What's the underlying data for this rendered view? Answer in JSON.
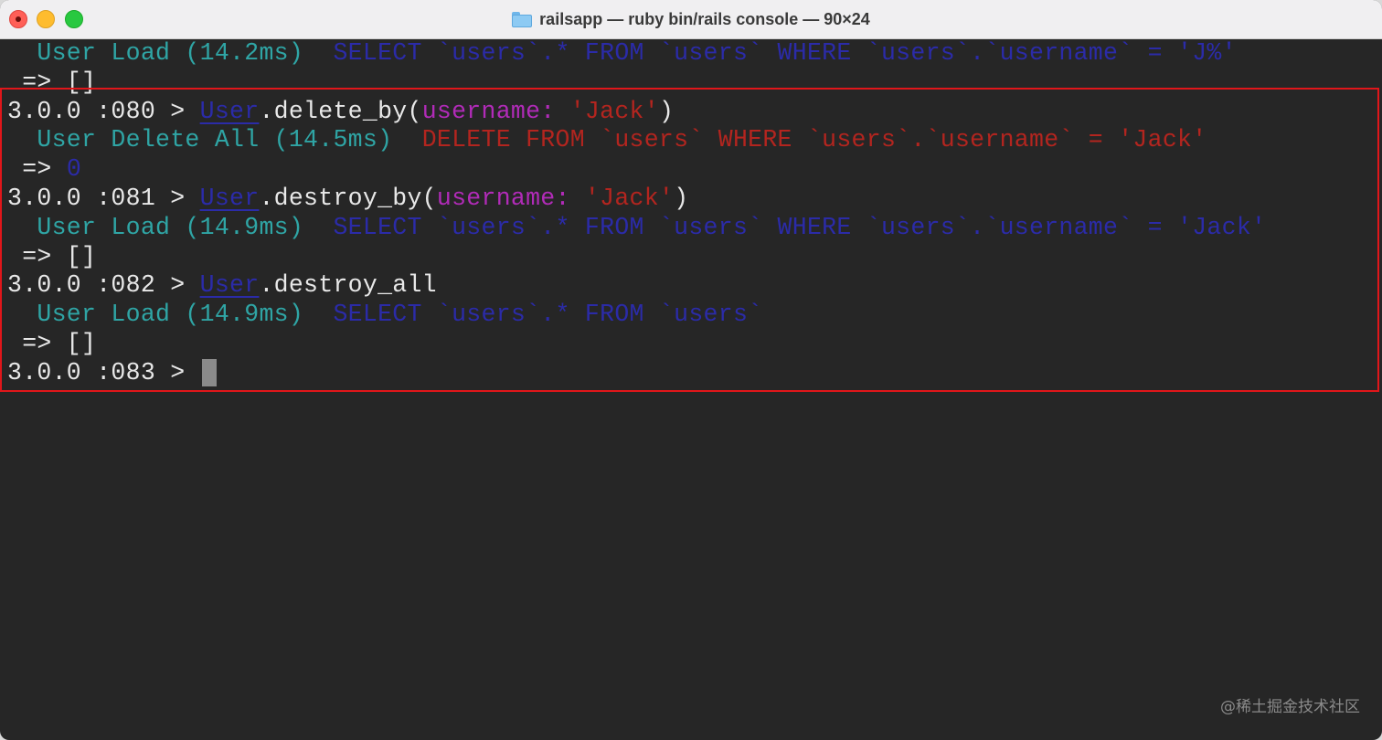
{
  "window": {
    "title": "railsapp — ruby bin/rails console — 90×24"
  },
  "terminal": {
    "lines": [
      {
        "segments": [
          {
            "t": "  User Load (14.2ms)  ",
            "c": "teal"
          },
          {
            "t": "SELECT `users`.* FROM `users` WHERE `users`.`username` = 'J%'",
            "c": "dblue"
          }
        ]
      },
      {
        "segments": [
          {
            "t": " => []",
            "c": "white"
          }
        ]
      },
      {
        "segments": [
          {
            "t": "3.0.0 :080 > ",
            "c": "white"
          },
          {
            "t": "User",
            "c": "model"
          },
          {
            "t": ".delete_by(",
            "c": "white"
          },
          {
            "t": "username:",
            "c": "purple"
          },
          {
            "t": " ",
            "c": "white"
          },
          {
            "t": "'Jack'",
            "c": "red"
          },
          {
            "t": ")",
            "c": "white"
          }
        ]
      },
      {
        "segments": [
          {
            "t": "  User Delete All (14.5ms)  ",
            "c": "teal"
          },
          {
            "t": "DELETE FROM `users` WHERE `users`.`username` = 'Jack'",
            "c": "red"
          }
        ]
      },
      {
        "segments": [
          {
            "t": " => ",
            "c": "white"
          },
          {
            "t": "0",
            "c": "dblue"
          }
        ]
      },
      {
        "segments": [
          {
            "t": "3.0.0 :081 > ",
            "c": "white"
          },
          {
            "t": "User",
            "c": "model"
          },
          {
            "t": ".destroy_by(",
            "c": "white"
          },
          {
            "t": "username:",
            "c": "purple"
          },
          {
            "t": " ",
            "c": "white"
          },
          {
            "t": "'Jack'",
            "c": "red"
          },
          {
            "t": ")",
            "c": "white"
          }
        ]
      },
      {
        "segments": [
          {
            "t": "  User Load (14.9ms)  ",
            "c": "teal"
          },
          {
            "t": "SELECT `users`.* FROM `users` WHERE `users`.`username` = 'Jack'",
            "c": "dblue"
          }
        ]
      },
      {
        "segments": [
          {
            "t": " => []",
            "c": "white"
          }
        ]
      },
      {
        "segments": [
          {
            "t": "3.0.0 :082 > ",
            "c": "white"
          },
          {
            "t": "User",
            "c": "model"
          },
          {
            "t": ".destroy_all",
            "c": "white"
          }
        ]
      },
      {
        "segments": [
          {
            "t": "  User Load (14.9ms)  ",
            "c": "teal"
          },
          {
            "t": "SELECT `users`.* FROM `users`",
            "c": "dblue"
          }
        ]
      },
      {
        "segments": [
          {
            "t": " => []",
            "c": "white"
          }
        ]
      },
      {
        "segments": [
          {
            "t": "3.0.0 :083 > ",
            "c": "white"
          }
        ],
        "cursor": true
      }
    ]
  },
  "watermark": "@稀土掘金技术社区",
  "icons": {
    "title_icon": "folder-icon"
  },
  "colors": {
    "teal": "#2fa5a5",
    "dark_blue": "#2b2ba8",
    "red": "#b3251f",
    "purple": "#b12bb8",
    "highlight": "#e0161a"
  }
}
